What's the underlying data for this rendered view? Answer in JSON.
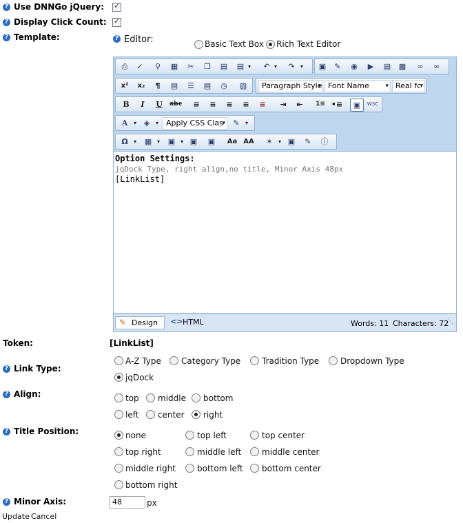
{
  "settings": {
    "use_jquery_label": "Use DNNGo jQuery:",
    "display_click_count_label": "Display Click Count:",
    "template_label": "Template:",
    "editor_label": "Editor:",
    "basic_text_box": "Basic Text Box",
    "rich_text_editor": "Rich Text Editor"
  },
  "toolbar": {
    "paragraph_style": "Paragraph Style",
    "font_name": "Font Name",
    "real_font": "Real fc",
    "apply_css": "Apply CSS Clas"
  },
  "editor_content": {
    "heading": "Option Settings:",
    "line1": "jqDock Type, right align,no title, Minor Axis 48px",
    "line2": "[LinkList]"
  },
  "editor_footer": {
    "design_tab": "Design",
    "html_tab": "HTML",
    "words": "Words: 11",
    "characters": "Characters: 72"
  },
  "token": {
    "label": "Token:",
    "value": "[LinkList]"
  },
  "link_type": {
    "label": "Link Type:",
    "options": [
      "A-Z Type",
      "Category Type",
      "Tradition Type",
      "Dropdown Type",
      "jqDock"
    ],
    "selected": "jqDock"
  },
  "align": {
    "label": "Align:",
    "options": [
      "top",
      "middle",
      "bottom",
      "left",
      "center",
      "right"
    ],
    "selected": "right"
  },
  "title_position": {
    "label": "Title Position:",
    "options": [
      "none",
      "top left",
      "top center",
      "top right",
      "middle left",
      "middle center",
      "middle right",
      "bottom left",
      "bottom center",
      "bottom right"
    ],
    "selected": "none"
  },
  "minor_axis": {
    "label": "Minor Axis:",
    "value": "48",
    "unit": "px"
  },
  "actions": {
    "update": "Update",
    "cancel": "Cancel"
  },
  "colors": {
    "help_icon": "#2a6cc4",
    "editor_frame": "#bed6ee",
    "toolbar": "#d7e5f4"
  }
}
